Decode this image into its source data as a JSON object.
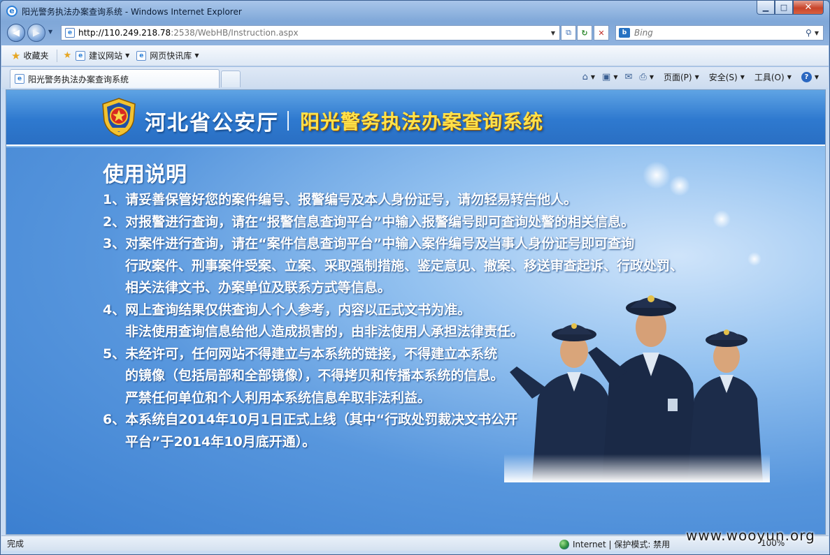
{
  "window": {
    "title": "阳光警务执法办案查询系统 - Windows Internet Explorer",
    "minimize": "▁",
    "maximize": "□",
    "close": "✕"
  },
  "address_bar": {
    "host": "http://110.249.218.78",
    "path": ":2538/WebHB/Instruction.aspx"
  },
  "search": {
    "placeholder": "Bing"
  },
  "favorites_bar": {
    "favorites_label": "收藏夹",
    "items": [
      {
        "label": "建议网站"
      },
      {
        "label": "网页快讯库"
      }
    ]
  },
  "tab": {
    "label": "阳光警务执法办案查询系统"
  },
  "command_bar": {
    "page": "页面(P)",
    "safety": "安全(S)",
    "tools": "工具(O)"
  },
  "page": {
    "department": "河北省公安厅",
    "system_name": "阳光警务执法办案查询系统",
    "heading": "使用说明",
    "lines": [
      {
        "text": "1、请妥善保管好您的案件编号、报警编号及本人身份证号，请勿轻易转告他人。",
        "indent": false
      },
      {
        "text": "2、对报警进行查询，请在“报警信息查询平台”中输入报警编号即可查询处警的相关信息。",
        "indent": false
      },
      {
        "text": "3、对案件进行查询，请在“案件信息查询平台”中输入案件编号及当事人身份证号即可查询",
        "indent": false
      },
      {
        "text": "行政案件、刑事案件受案、立案、采取强制措施、鉴定意见、撤案、移送审查起诉、行政处罚、",
        "indent": true
      },
      {
        "text": "相关法律文书、办案单位及联系方式等信息。",
        "indent": true
      },
      {
        "text": "4、网上查询结果仅供查询人个人参考，内容以正式文书为准。",
        "indent": false
      },
      {
        "text": "非法使用查询信息给他人造成损害的，由非法使用人承担法律责任。",
        "indent": true
      },
      {
        "text": "5、未经许可，任何网站不得建立与本系统的链接，不得建立本系统",
        "indent": false
      },
      {
        "text": "的镜像（包括局部和全部镜像），不得拷贝和传播本系统的信息。",
        "indent": true
      },
      {
        "text": "严禁任何单位和个人利用本系统信息牟取非法利益。",
        "indent": true
      },
      {
        "text": "6、本系统自2014年10月1日正式上线（其中“行政处罚裁决文书公开",
        "indent": false
      },
      {
        "text": "平台”于2014年10月底开通）。",
        "indent": true
      }
    ]
  },
  "status_bar": {
    "status": "完成",
    "zone": "Internet | 保护模式: 禁用",
    "zoom": "100%"
  },
  "watermark": "www.wooyun.org",
  "colors": {
    "banner_blue": "#2e79cf",
    "system_name_yellow": "#ffe24a",
    "body_text": "#ffffff"
  }
}
